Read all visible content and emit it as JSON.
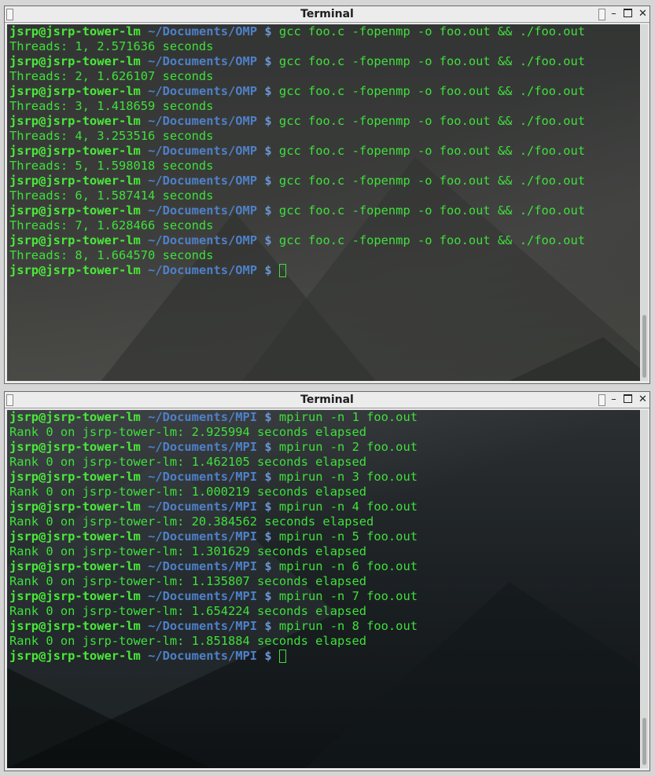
{
  "windows": [
    {
      "title": "Terminal",
      "prompt_user": "jsrp@jsrp-tower-lm",
      "prompt_path": "~/Documents/OMP",
      "prompt_symbol": "$",
      "lines": [
        {
          "cmd": "gcc foo.c -fopenmp -o foo.out && ./foo.out",
          "out": "Threads: 1, 2.571636 seconds"
        },
        {
          "cmd": "gcc foo.c -fopenmp -o foo.out && ./foo.out",
          "out": "Threads: 2, 1.626107 seconds"
        },
        {
          "cmd": "gcc foo.c -fopenmp -o foo.out && ./foo.out",
          "out": "Threads: 3, 1.418659 seconds"
        },
        {
          "cmd": "gcc foo.c -fopenmp -o foo.out && ./foo.out",
          "out": "Threads: 4, 3.253516 seconds"
        },
        {
          "cmd": "gcc foo.c -fopenmp -o foo.out && ./foo.out",
          "out": "Threads: 5, 1.598018 seconds"
        },
        {
          "cmd": "gcc foo.c -fopenmp -o foo.out && ./foo.out",
          "out": "Threads: 6, 1.587414 seconds"
        },
        {
          "cmd": "gcc foo.c -fopenmp -o foo.out && ./foo.out",
          "out": "Threads: 7, 1.628466 seconds"
        },
        {
          "cmd": "gcc foo.c -fopenmp -o foo.out && ./foo.out",
          "out": "Threads: 8, 1.664570 seconds"
        }
      ]
    },
    {
      "title": "Terminal",
      "prompt_user": "jsrp@jsrp-tower-lm",
      "prompt_path": "~/Documents/MPI",
      "prompt_symbol": "$",
      "lines": [
        {
          "cmd": "mpirun -n 1 foo.out",
          "out": "Rank 0 on jsrp-tower-lm: 2.925994 seconds elapsed"
        },
        {
          "cmd": "mpirun -n 2 foo.out",
          "out": "Rank 0 on jsrp-tower-lm: 1.462105 seconds elapsed"
        },
        {
          "cmd": "mpirun -n 3 foo.out",
          "out": "Rank 0 on jsrp-tower-lm: 1.000219 seconds elapsed"
        },
        {
          "cmd": "mpirun -n 4 foo.out",
          "out": "Rank 0 on jsrp-tower-lm: 20.384562 seconds elapsed"
        },
        {
          "cmd": "mpirun -n 5 foo.out",
          "out": "Rank 0 on jsrp-tower-lm: 1.301629 seconds elapsed"
        },
        {
          "cmd": "mpirun -n 6 foo.out",
          "out": "Rank 0 on jsrp-tower-lm: 1.135807 seconds elapsed"
        },
        {
          "cmd": "mpirun -n 7 foo.out",
          "out": "Rank 0 on jsrp-tower-lm: 1.654224 seconds elapsed"
        },
        {
          "cmd": "mpirun -n 8 foo.out",
          "out": "Rank 0 on jsrp-tower-lm: 1.851884 seconds elapsed"
        }
      ]
    }
  ],
  "icons": {
    "minimize": "minimize-icon",
    "maximize": "maximize-icon",
    "close": "close-icon"
  },
  "colors": {
    "prompt_user": "#4ae93a",
    "prompt_path": "#4f80c7",
    "output": "#3fe03b"
  }
}
